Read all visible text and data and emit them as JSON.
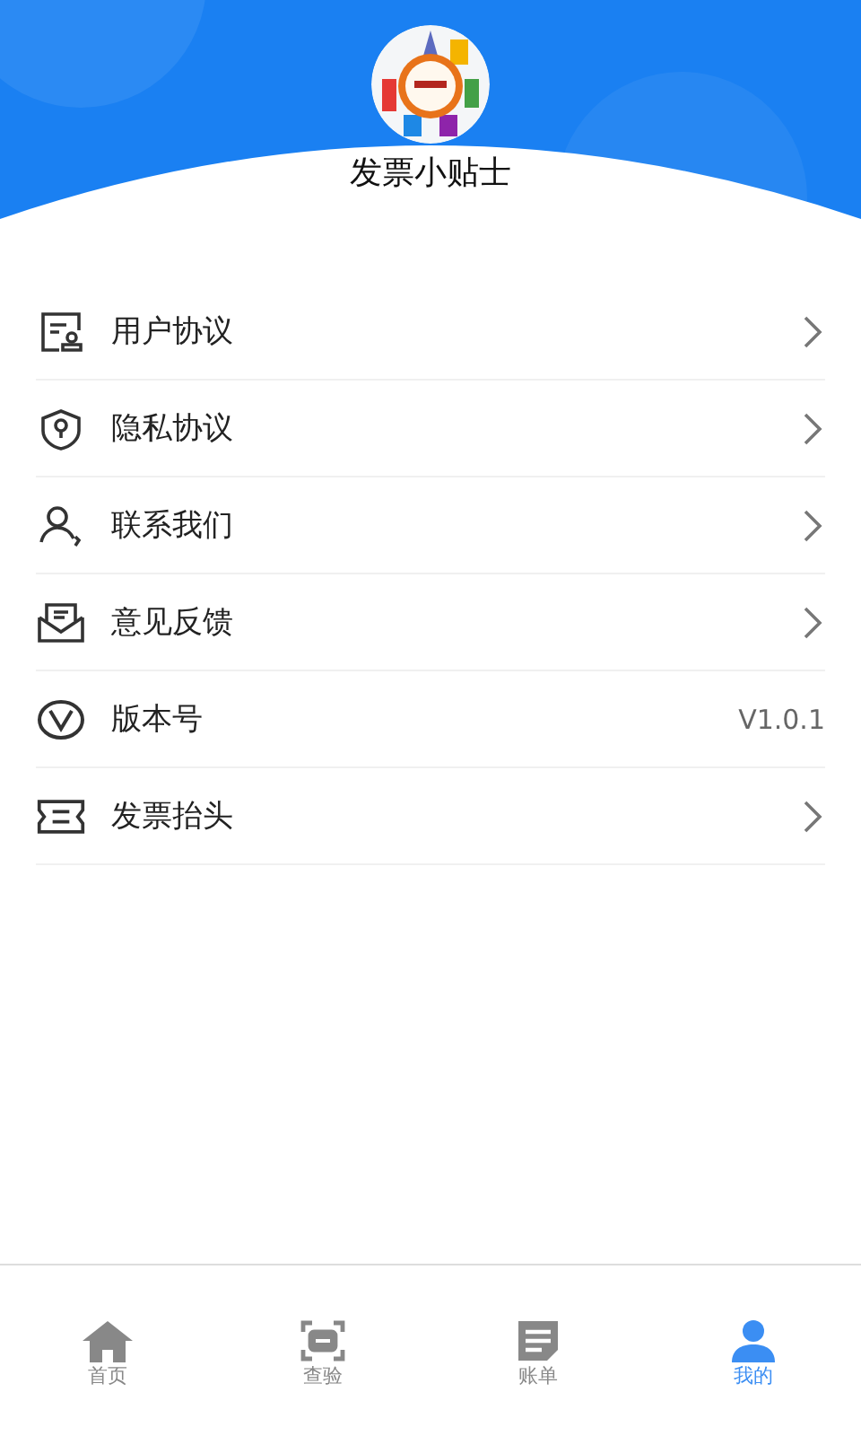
{
  "header": {
    "title": "发票小贴士"
  },
  "menu": [
    {
      "kind": "link",
      "label": "用户协议"
    },
    {
      "kind": "link",
      "label": "隐私协议"
    },
    {
      "kind": "link",
      "label": "联系我们"
    },
    {
      "kind": "link",
      "label": "意见反馈"
    },
    {
      "kind": "value",
      "label": "版本号",
      "value": "V1.0.1"
    },
    {
      "kind": "link",
      "label": "发票抬头"
    }
  ],
  "tab_bar": [
    {
      "label": "首页",
      "selected": false
    },
    {
      "label": "查验",
      "selected": false
    },
    {
      "label": "账单",
      "selected": false
    },
    {
      "label": "我的",
      "selected": true
    }
  ]
}
